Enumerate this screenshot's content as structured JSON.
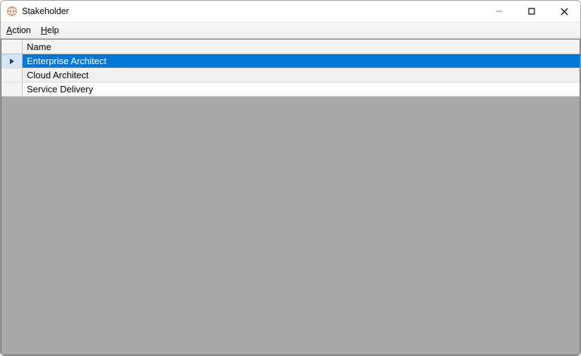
{
  "window": {
    "title": "Stakeholder"
  },
  "menu": {
    "action": "Action",
    "help": "Help"
  },
  "grid": {
    "columns": {
      "name": "Name"
    },
    "rows": [
      {
        "name": "Enterprise Architect",
        "selected": true
      },
      {
        "name": "Cloud Architect",
        "selected": false
      },
      {
        "name": "Service Delivery",
        "selected": false
      }
    ]
  }
}
